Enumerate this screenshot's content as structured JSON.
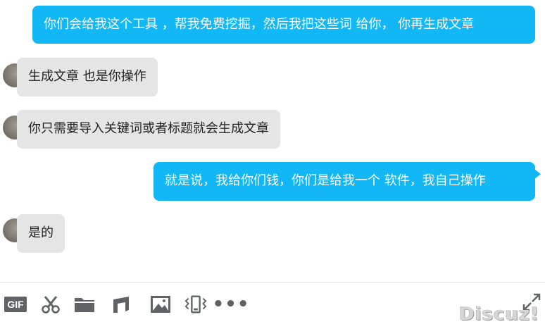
{
  "colors": {
    "outgoing_bubble": "#12b7f5",
    "incoming_bubble": "#e5e5e5",
    "icon": "#606266"
  },
  "messages": [
    {
      "side": "right",
      "text": "你们会给我这个工具 ，帮我免费挖掘，然后我把这些词 给你，  你再生成文章"
    },
    {
      "side": "left",
      "text": "生成文章 也是你操作"
    },
    {
      "side": "left",
      "text": "你只需要导入关键词或者标题就会生成文章"
    },
    {
      "side": "right",
      "text": "就是说，我给你们钱，你们是给我一个 软件，我自己操作"
    },
    {
      "side": "left",
      "text": "是的"
    }
  ],
  "toolbar": {
    "gif_label": "GIF",
    "icons": [
      "gif-icon",
      "scissors-icon",
      "folder-icon",
      "music-icon",
      "image-icon",
      "shake-icon",
      "more-icon",
      "expand-icon"
    ],
    "more_label": "•••"
  },
  "watermark": "Discuz!"
}
